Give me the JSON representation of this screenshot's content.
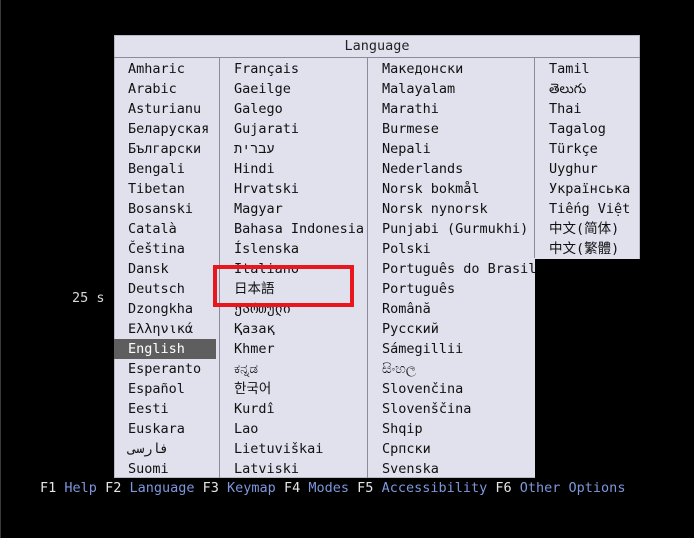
{
  "timer": "25 s",
  "dialog_title": "Language",
  "selected_language": "English",
  "columns": [
    [
      "Amharic",
      "Arabic",
      "Asturianu",
      "Беларуская",
      "Български",
      "Bengali",
      "Tibetan",
      "Bosanski",
      "Català",
      "Čeština",
      "Dansk",
      "Deutsch",
      "Dzongkha",
      "Ελληνικά",
      "English",
      "Esperanto",
      "Español",
      "Eesti",
      "Euskara",
      "فارسی",
      "Suomi"
    ],
    [
      "Français",
      "Gaeilge",
      "Galego",
      "Gujarati",
      "עברית",
      "Hindi",
      "Hrvatski",
      "Magyar",
      "Bahasa Indonesia",
      "Íslenska",
      "Italiano",
      "日本語",
      "ქართული",
      "Қазақ",
      "Khmer",
      "ಕನ್ನಡ",
      "한국어",
      "Kurdî",
      "Lao",
      "Lietuviškai",
      "Latviski"
    ],
    [
      "Македонски",
      "Malayalam",
      "Marathi",
      "Burmese",
      "Nepali",
      "Nederlands",
      "Norsk bokmål",
      "Norsk nynorsk",
      "Punjabi (Gurmukhi)",
      "Polski",
      "Português do Brasil",
      "Português",
      "Română",
      "Русский",
      "Sámegillii",
      "සිංහල",
      "Slovenčina",
      "Slovenščina",
      "Shqip",
      "Српски",
      "Svenska"
    ],
    [
      "Tamil",
      "తెలుగు",
      "Thai",
      "Tagalog",
      "Türkçe",
      "Uyghur",
      "Українська",
      "Tiếng Việt",
      "中文(简体)",
      "中文(繁體)"
    ]
  ],
  "function_keys": [
    {
      "key": "F1",
      "label": "Help"
    },
    {
      "key": "F2",
      "label": "Language"
    },
    {
      "key": "F3",
      "label": "Keymap"
    },
    {
      "key": "F4",
      "label": "Modes"
    },
    {
      "key": "F5",
      "label": "Accessibility"
    },
    {
      "key": "F6",
      "label": "Other Options"
    }
  ],
  "colors": {
    "background": "#000000",
    "dialog": "#e1e1ee",
    "selection": "#5e5e5e",
    "fkey_label": "#7c97dd",
    "annotation": "#e8161d"
  }
}
